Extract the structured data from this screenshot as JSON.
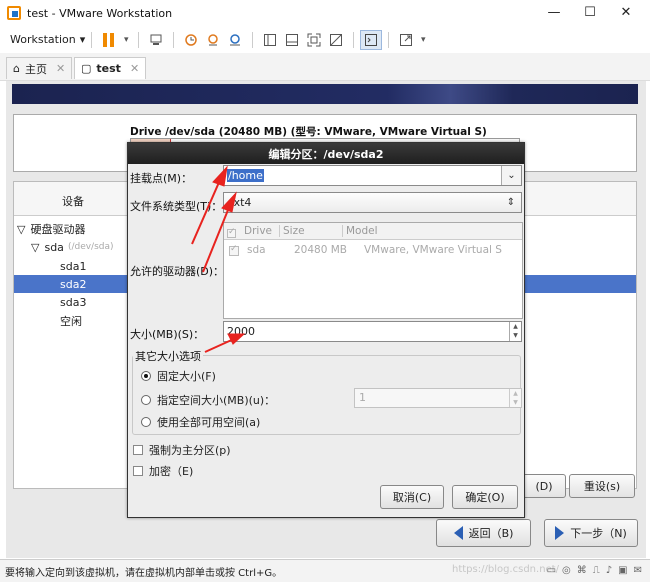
{
  "window": {
    "title": "test - VMware Workstation",
    "minimize": "—",
    "maximize": "☐",
    "close": "✕"
  },
  "toolbar": {
    "workstation_label": "Workstation",
    "dropdown_glyph": "▾"
  },
  "tabs": [
    {
      "label": "主页",
      "close": "✕"
    },
    {
      "label": "test",
      "close": "✕"
    }
  ],
  "drive": {
    "title": "Drive /dev/sda (20480 MB) (型号: VMware, VMware Virtual S)"
  },
  "tree": {
    "header": "设备",
    "items": [
      {
        "label": "硬盘驱动器",
        "expander": "▽"
      },
      {
        "label": "sda",
        "sub": "(/dev/sda)",
        "expander": "▽"
      },
      {
        "label": "sda1"
      },
      {
        "label": "sda2"
      },
      {
        "label": "sda3"
      },
      {
        "label": "空闲"
      }
    ]
  },
  "main_buttons": {
    "delete_label": "(D)",
    "reset_label": "重设(s)",
    "back_label": "返回（B)",
    "next_label": "下一步（N)"
  },
  "dialog": {
    "title": "编辑分区：/dev/sda2",
    "mount_label": "挂载点(M)：",
    "mount_value": "/home",
    "fs_label": "文件系统类型(T)：",
    "fs_value": "ext4",
    "drives_label": "允许的驱动器(D)：",
    "drives_table": {
      "columns": [
        "Drive",
        "Size",
        "Model"
      ],
      "row": {
        "drive": "sda",
        "size": "20480 MB",
        "model": "VMware, VMware Virtual S"
      }
    },
    "size_label": "大小(MB)(S)：",
    "size_value": "2000",
    "other_size_legend": "其它大小选项",
    "options": {
      "fixed": "固定大小(F)",
      "up_to": "指定空间大小(MB)(u)：",
      "fill_all": "使用全部可用空间(a)"
    },
    "up_to_value": "1",
    "force_primary": "强制为主分区(p)",
    "encrypt": "加密（E)",
    "cancel": "取消(C)",
    "ok": "确定(O)"
  },
  "status": {
    "text": "要将输入定向到该虚拟机，请在虚拟机内部单击或按 Ctrl+G。",
    "watermark": "https://blog.csdn.net/"
  },
  "colors": {
    "selection": "#4a74c9",
    "annotation_arrow": "#e8231f",
    "accent_orange": "#f08a00"
  }
}
